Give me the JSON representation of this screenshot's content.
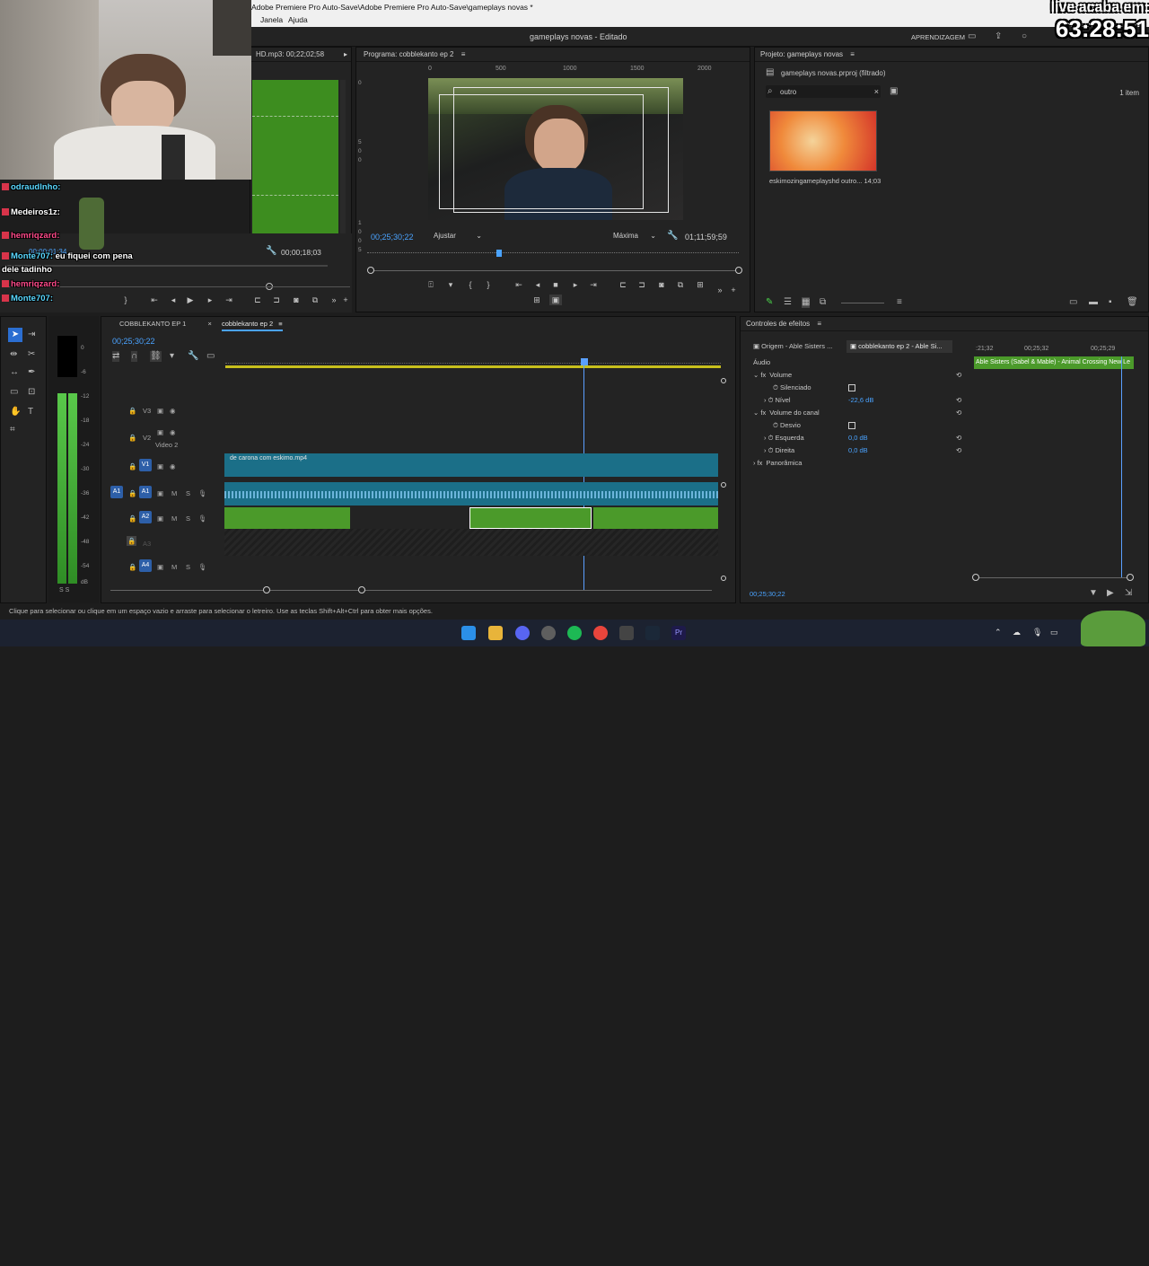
{
  "window": {
    "title": "Adobe Premiere Pro Auto-Save\\Adobe Premiere Pro Auto-Save\\gameplays novas *",
    "menu": [
      "Janela",
      "Ajuda"
    ]
  },
  "header": {
    "project_title": "gameplays novas - Editado",
    "learning_label": "APRENDIZAGEM"
  },
  "overlay": {
    "live_line1": "live acaba em:",
    "live_time": "63:28:51",
    "chat": [
      {
        "user": "odraudlnho:",
        "text": ""
      },
      {
        "user": "Medeiros1z:",
        "text": ""
      },
      {
        "user": "hemriqzard:",
        "text": ""
      },
      {
        "user": "Monte707:",
        "text": "eu fiquei com pena"
      },
      {
        "user": "",
        "text": "dele tadinho"
      },
      {
        "user": "hemriqzard:",
        "text": ""
      },
      {
        "user": "Monte707:",
        "text": ""
      }
    ]
  },
  "source_panel": {
    "tab_label": "HD.mp3: 00;22;02;58",
    "timecode_left": "00;00;01;34",
    "timecode_right": "00;00;18;03"
  },
  "program_panel": {
    "tab_label": "Programa: cobblekanto ep 2",
    "ruler": [
      "0",
      "500",
      "1000",
      "1500",
      "2000"
    ],
    "vruler": [
      "0",
      "5",
      "0",
      "0",
      "1",
      "0",
      "0",
      "5"
    ],
    "timecode": "00;25;30;22",
    "fit_label": "Ajustar",
    "quality_label": "Máxima",
    "duration": "01;11;59;59"
  },
  "project_panel": {
    "tab_label": "Projeto: gameplays novas",
    "file_label": "gameplays novas.prproj (filtrado)",
    "search_value": "outro",
    "item_count": "1 item",
    "clip_name": "eskimozingameplayshd outro...",
    "clip_duration": "14;03"
  },
  "timeline": {
    "tabs": [
      "COBBLEKANTO EP 1",
      "cobblekanto ep 2"
    ],
    "timecode": "00;25;30;22",
    "video_clip_label": "de carona com eskimo.mp4",
    "tracks": [
      {
        "id": "V3",
        "name": ""
      },
      {
        "id": "V2",
        "name": "Video 2"
      },
      {
        "id": "V1",
        "name": ""
      },
      {
        "id": "A1",
        "name": ""
      },
      {
        "id": "A2",
        "name": ""
      },
      {
        "id": "A3",
        "name": ""
      },
      {
        "id": "A4",
        "name": ""
      }
    ]
  },
  "meter": {
    "scale": [
      "0",
      "-6",
      "-12",
      "-18",
      "-24",
      "-30",
      "-36",
      "-42",
      "-48",
      "-54",
      "dB"
    ],
    "lr": "S S"
  },
  "effect_controls": {
    "tab_label": "Controles de efeitos",
    "source_tab": "Origem - Able Sisters ...",
    "seq_tab": "cobblekanto ep 2 - Able Si...",
    "section_audio": "Áudio",
    "ruler": [
      ":21;32",
      "00;25;32",
      "00;25;29"
    ],
    "clip_label": "Able Sisters (Sabel & Mable) - Animal Crossing New Le",
    "rows": [
      {
        "label": "Volume",
        "value": ""
      },
      {
        "label": "Silenciado",
        "value": ""
      },
      {
        "label": "Nível",
        "value": "-22,6 dB"
      },
      {
        "label": "Volume do canal",
        "value": ""
      },
      {
        "label": "Desvio",
        "value": ""
      },
      {
        "label": "Esquerda",
        "value": "0,0 dB"
      },
      {
        "label": "Direita",
        "value": "0,0 dB"
      },
      {
        "label": "Panorâmica",
        "value": ""
      }
    ],
    "timecode": "00;25;30;22"
  },
  "status_bar": {
    "text": "Clique para selecionar ou clique em um espaço vazio e arraste para selecionar o letreiro. Use as teclas Shift+Alt+Ctrl para obter mais opções."
  },
  "colors": {
    "accent_blue": "#2b6ed1",
    "clip_teal": "#1b6f88",
    "audio_green": "#4b9a2a",
    "playhead": "#5aa0ff"
  }
}
